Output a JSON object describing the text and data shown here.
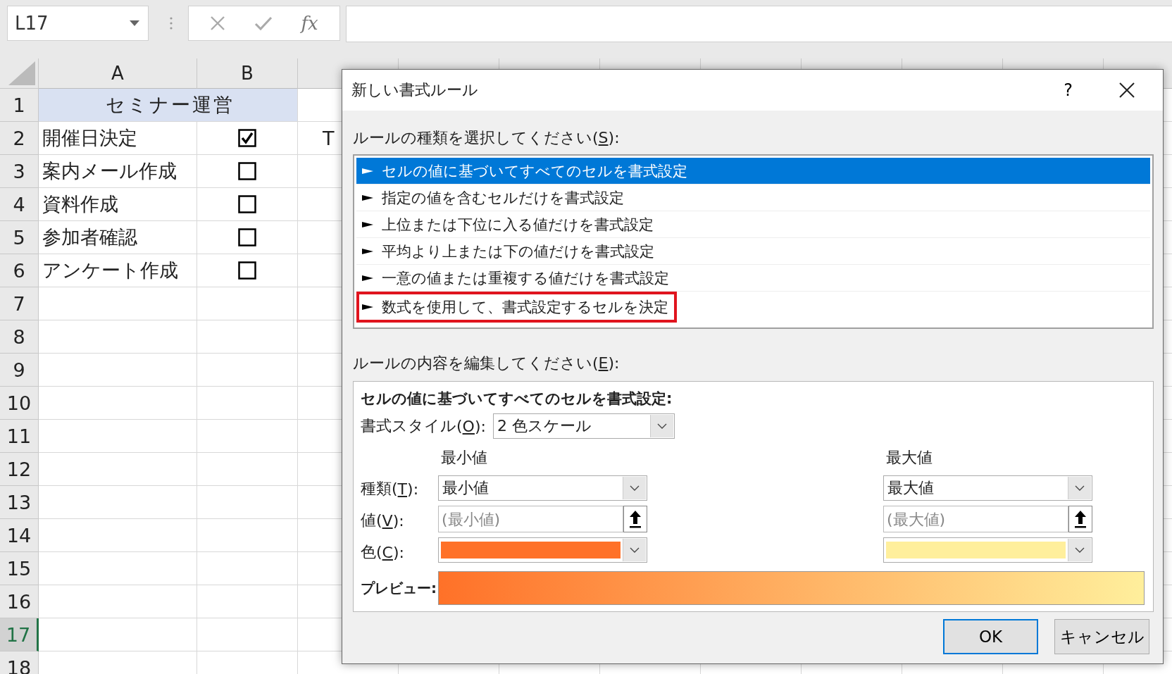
{
  "formula_bar": {
    "name_box": "L17",
    "function_label": "fx"
  },
  "sheet": {
    "columns": [
      "A",
      "B"
    ],
    "rows": [
      {
        "number": "1",
        "kind": "title",
        "text": "セミナー運営",
        "selected": false
      },
      {
        "number": "2",
        "kind": "task",
        "text": "開催日決定",
        "checked": true,
        "column_c": "T",
        "selected": false
      },
      {
        "number": "3",
        "kind": "task",
        "text": "案内メール作成",
        "checked": false,
        "selected": false
      },
      {
        "number": "4",
        "kind": "task",
        "text": "資料作成",
        "checked": false,
        "selected": false
      },
      {
        "number": "5",
        "kind": "task",
        "text": "参加者確認",
        "checked": false,
        "selected": false
      },
      {
        "number": "6",
        "kind": "task",
        "text": "アンケート作成",
        "checked": false,
        "selected": false
      },
      {
        "number": "7",
        "kind": "empty",
        "selected": false
      },
      {
        "number": "8",
        "kind": "empty",
        "selected": false
      },
      {
        "number": "9",
        "kind": "empty",
        "selected": false
      },
      {
        "number": "10",
        "kind": "empty",
        "selected": false
      },
      {
        "number": "11",
        "kind": "empty",
        "selected": false
      },
      {
        "number": "12",
        "kind": "empty",
        "selected": false
      },
      {
        "number": "13",
        "kind": "empty",
        "selected": false
      },
      {
        "number": "14",
        "kind": "empty",
        "selected": false
      },
      {
        "number": "15",
        "kind": "empty",
        "selected": false
      },
      {
        "number": "16",
        "kind": "empty",
        "selected": false
      },
      {
        "number": "17",
        "kind": "empty",
        "selected": true
      },
      {
        "number": "18",
        "kind": "empty",
        "selected": false
      }
    ]
  },
  "dialog": {
    "title": "新しい書式ルール",
    "help": "?",
    "rule_type_label": {
      "before": "ルールの種類を選択してください(",
      "key": "S",
      "after": "):"
    },
    "rule_types": [
      {
        "label": "セルの値に基づいてすべてのセルを書式設定",
        "selected": true,
        "highlighted": false
      },
      {
        "label": "指定の値を含むセルだけを書式設定",
        "selected": false,
        "highlighted": false
      },
      {
        "label": "上位または下位に入る値だけを書式設定",
        "selected": false,
        "highlighted": false
      },
      {
        "label": "平均より上または下の値だけを書式設定",
        "selected": false,
        "highlighted": false
      },
      {
        "label": "一意の値または重複する値だけを書式設定",
        "selected": false,
        "highlighted": false
      },
      {
        "label": "数式を使用して、書式設定するセルを決定",
        "selected": false,
        "highlighted": true
      }
    ],
    "edit_label": {
      "before": "ルールの内容を編集してください(",
      "key": "E",
      "after": "):"
    },
    "edit_title": "セルの値に基づいてすべてのセルを書式設定:",
    "style_label": {
      "before": "書式スタイル(",
      "key": "O",
      "after": "):"
    },
    "style_value": "2 色スケール",
    "type_label": {
      "before": "種類(",
      "key": "T",
      "after": "):"
    },
    "value_label": {
      "before": "値(",
      "key": "V",
      "after": "):"
    },
    "color_label": {
      "before": "色(",
      "key": "C",
      "after": "):"
    },
    "minimum": {
      "heading": "最小値",
      "type": "最小値",
      "placeholder": "(最小値)",
      "color": "#ff7128"
    },
    "maximum": {
      "heading": "最大値",
      "type": "最大値",
      "placeholder": "(最大値)",
      "color": "#ffef9c"
    },
    "preview_label": "プレビュー:",
    "buttons": [
      {
        "label": "OK",
        "default": true
      },
      {
        "label": "キャンセル",
        "default": false
      }
    ]
  }
}
